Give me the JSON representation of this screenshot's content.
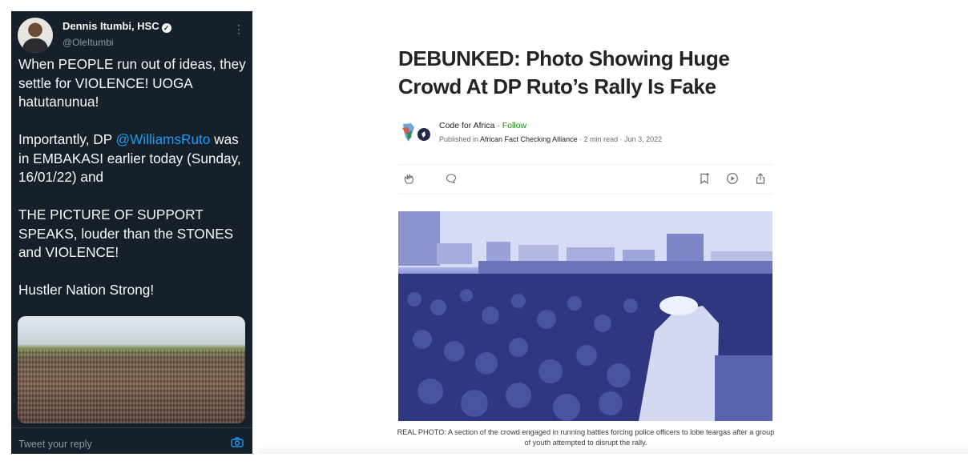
{
  "tweet": {
    "display_name": "Dennis Itumbi, HSC",
    "handle": "@OleItumbi",
    "paragraph_1": "When PEOPLE run out of ideas, they settle for VIOLENCE! UOGA hatutanunua!",
    "paragraph_2_prefix": "Importantly, DP ",
    "paragraph_2_mention": "@WilliamsRuto",
    "paragraph_2_suffix": " was in EMBAKASI earlier today (Sunday, 16/01/22) and",
    "paragraph_3": "THE PICTURE OF SUPPORT SPEAKS, louder than the STONES and VIOLENCE!",
    "paragraph_4": "Hustler Nation Strong!",
    "reply_placeholder": "Tweet your reply",
    "more_icon": "more-options-icon",
    "verified_icon": "verified-badge-icon",
    "camera_icon": "camera-icon",
    "mention_color": "#1d9bf0",
    "background_color": "#15202b"
  },
  "article": {
    "title": "DEBUNKED: Photo Showing Huge Crowd At DP Ruto’s Rally Is Fake",
    "author": "Code for Africa",
    "separator": " · ",
    "follow_label": "Follow",
    "published_prefix": "Published in ",
    "publication": "African Fact Checking Alliance",
    "read_time": "2 min read",
    "date": "Jun 3, 2022",
    "actions": [
      "clap-icon",
      "comment-icon",
      "bookmark-icon",
      "listen-play-icon",
      "share-icon"
    ],
    "caption": "REAL PHOTO: A section of the crowd engaged in running battles forcing police officers to lobe teargas after a group of youth attempted to disrupt the rally.",
    "follow_color": "#1a8917"
  }
}
